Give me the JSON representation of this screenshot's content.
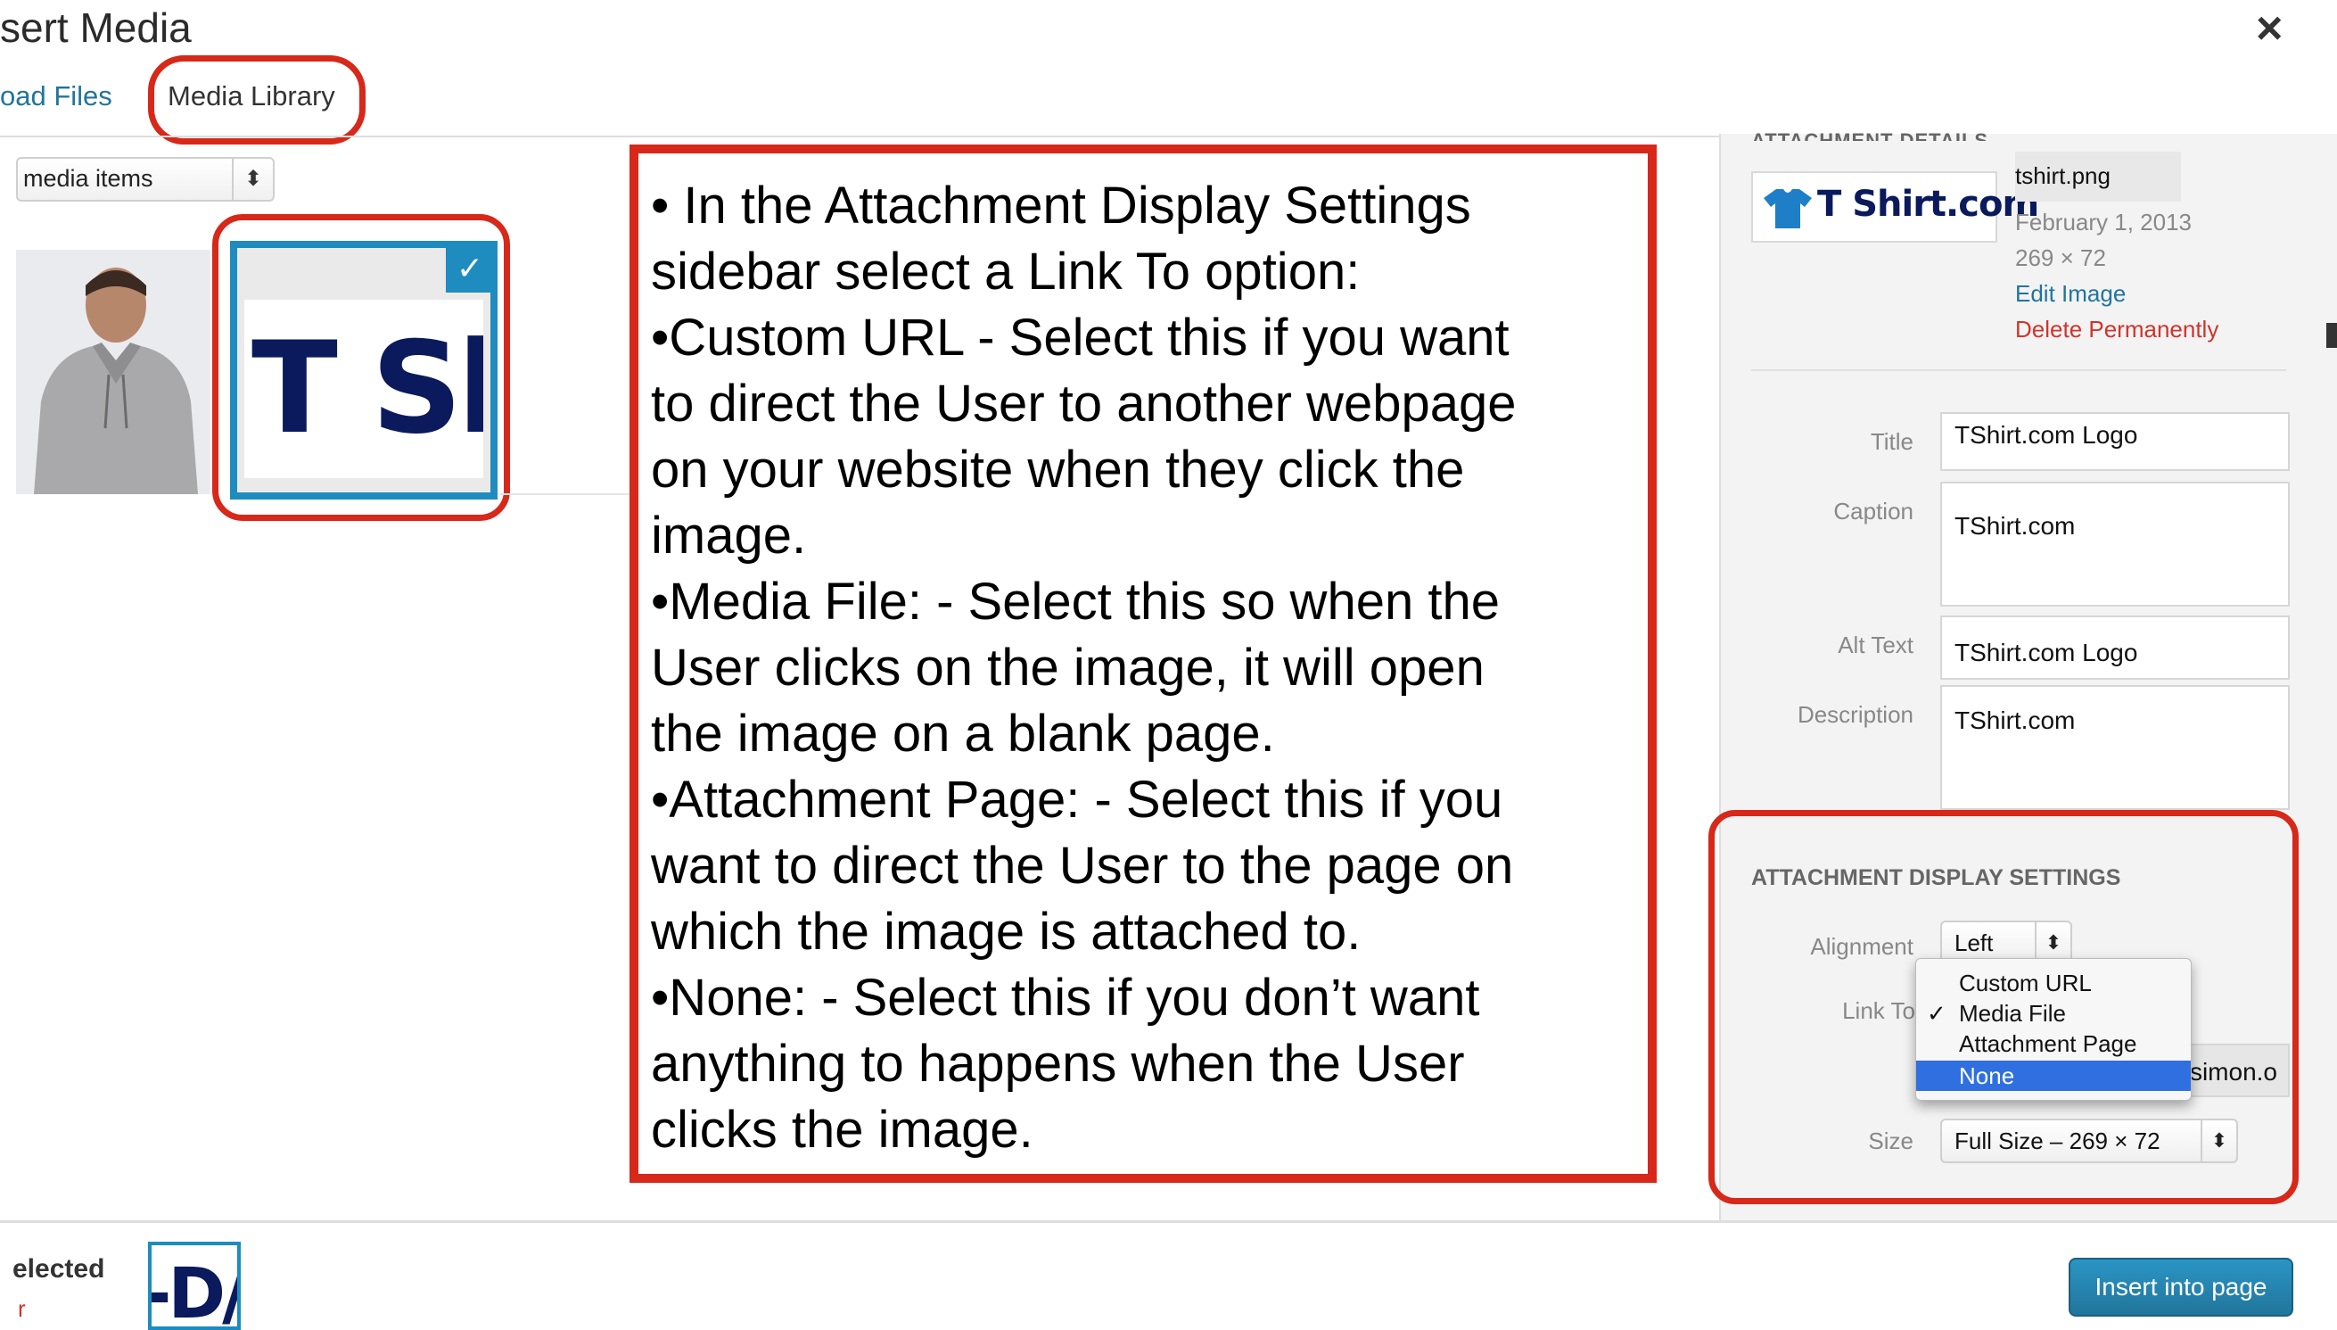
{
  "modal": {
    "title": "sert Media",
    "close": "×"
  },
  "tabs": {
    "upload": "oad Files",
    "library": "Media Library"
  },
  "filter": {
    "selected": "media items"
  },
  "grid": {
    "logo_thumb_text": "T Shir",
    "check": "✓"
  },
  "callout": {
    "lines": [
      "• In the Attachment Display Settings",
      "sidebar select a Link To option:",
      "•Custom URL - Select this if you want",
      "to direct the User to another webpage",
      "on your website when they click the",
      "image.",
      "•Media File: - Select this so when the",
      "User clicks on the image, it will open",
      "the image on a blank page.",
      "•Attachment Page: - Select this if you",
      "want to direct the User to the page on",
      "which the image is attached to.",
      "•None: - Select this if you don’t want",
      "anything to happens when the User",
      "clicks the image."
    ]
  },
  "details": {
    "heading": "ATTACHMENT DETAILS",
    "logo_text": "T Shirt.com",
    "filename": "tshirt.png",
    "date": "February 1, 2013",
    "dimensions": "269 × 72",
    "edit": "Edit Image",
    "delete": "Delete Permanently"
  },
  "fields": {
    "title_label": "Title",
    "title_value": "TShirt.com Logo",
    "caption_label": "Caption",
    "caption_value": "TShirt.com",
    "alt_label": "Alt Text",
    "alt_value": "TShirt.com Logo",
    "description_label": "Description",
    "description_value": "TShirt.com"
  },
  "display_settings": {
    "heading": "ATTACHMENT DISPLAY SETTINGS",
    "alignment_label": "Alignment",
    "alignment_value": "Left",
    "link_to_label": "Link To",
    "link_options": [
      "Custom URL",
      "Media File",
      "Attachment Page",
      "None"
    ],
    "checked_option": "Media File",
    "highlighted_option": "None",
    "check_mark": "✓",
    "url_value": "simon.o",
    "size_label": "Size",
    "size_value": "Full Size – 269 × 72"
  },
  "footer": {
    "selected_text": "elected",
    "clear_text": "r",
    "mini_thumb_text": "-D/",
    "insert_button": "Insert into page"
  },
  "colors": {
    "annotation_red": "#d7281a",
    "wp_blue": "#21759b",
    "selection_blue": "#1e8cbe",
    "delete_red": "#d0342c",
    "menu_highlight": "#2f6fe0"
  }
}
